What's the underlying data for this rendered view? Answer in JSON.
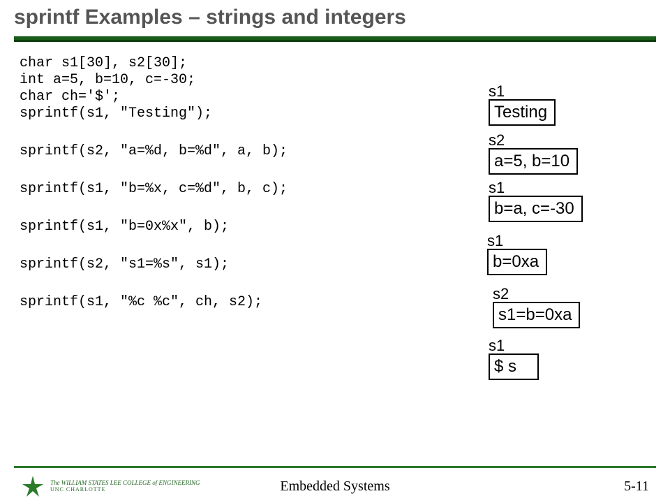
{
  "title": "sprintf Examples – strings and integers",
  "code": {
    "l1": "char s1[30], s2[30];",
    "l2": "int a=5, b=10, c=-30;",
    "l3": "char ch='$';",
    "l4": "sprintf(s1, \"Testing\");",
    "l5": "sprintf(s2, \"a=%d, b=%d\", a, b);",
    "l6": "sprintf(s1, \"b=%x, c=%d\", b, c);",
    "l7": "sprintf(s1, \"b=0x%x\", b);",
    "l8": "sprintf(s2, \"s1=%s\", s1);",
    "l9": "sprintf(s1, \"%c %c\", ch, s2);"
  },
  "outputs": {
    "o1": {
      "label": "s1",
      "value": "Testing"
    },
    "o2": {
      "label": "s2",
      "value": "a=5, b=10"
    },
    "o3": {
      "label": "s1",
      "value": "b=a, c=-30"
    },
    "o4": {
      "label": "s1",
      "value": "b=0xa"
    },
    "o5": {
      "label": "s2",
      "value": "s1=b=0xa"
    },
    "o6": {
      "label": "s1",
      "value": "$ s"
    }
  },
  "footer": {
    "center": "Embedded Systems",
    "right": "5-11",
    "college1": "The WILLIAM STATES LEE COLLEGE of ENGINEERING",
    "college2": "UNC CHARLOTTE"
  }
}
